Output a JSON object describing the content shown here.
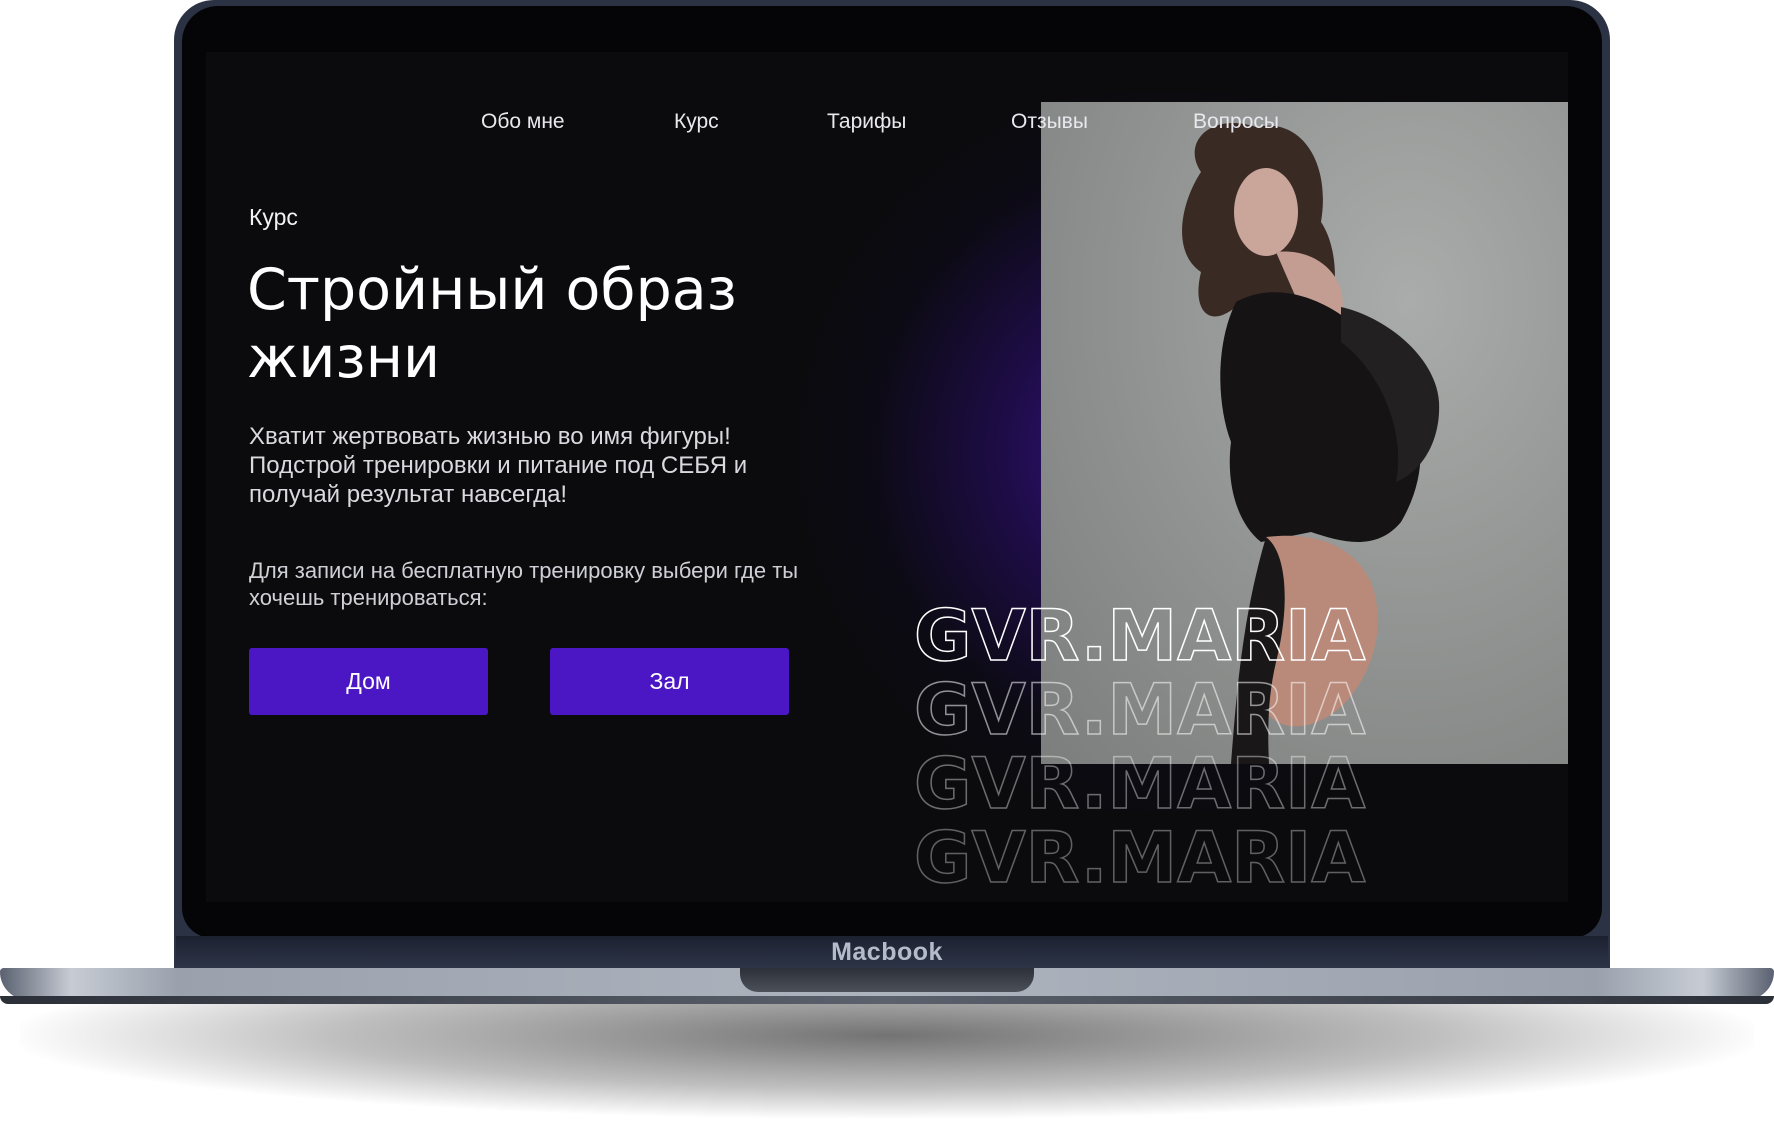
{
  "device": {
    "brand_label": "Macbook"
  },
  "nav": {
    "items": [
      {
        "label": "Обо мне"
      },
      {
        "label": "Курс"
      },
      {
        "label": "Тарифы"
      },
      {
        "label": "Отзывы"
      },
      {
        "label": "Вопросы"
      }
    ]
  },
  "hero": {
    "eyebrow": "Курс",
    "title": "Стройный образ жизни",
    "lead": "Хватит жертвовать жизнью во имя фигуры! Подстрой тренировки и питание под СЕБЯ и получай результат навсегда!",
    "prompt": "Для записи на бесплатную тренировку выбери где ты хочешь тренироваться:",
    "buttons": {
      "home": "Дом",
      "gym": "Зал"
    }
  },
  "watermark": {
    "text": "GVR.MARIA",
    "repeat": 4
  },
  "colors": {
    "accent": "#4b17c4",
    "background": "#0b0b0d",
    "glow": "#4e14be"
  },
  "icons": {
    "photo": "model-portrait-photo"
  }
}
